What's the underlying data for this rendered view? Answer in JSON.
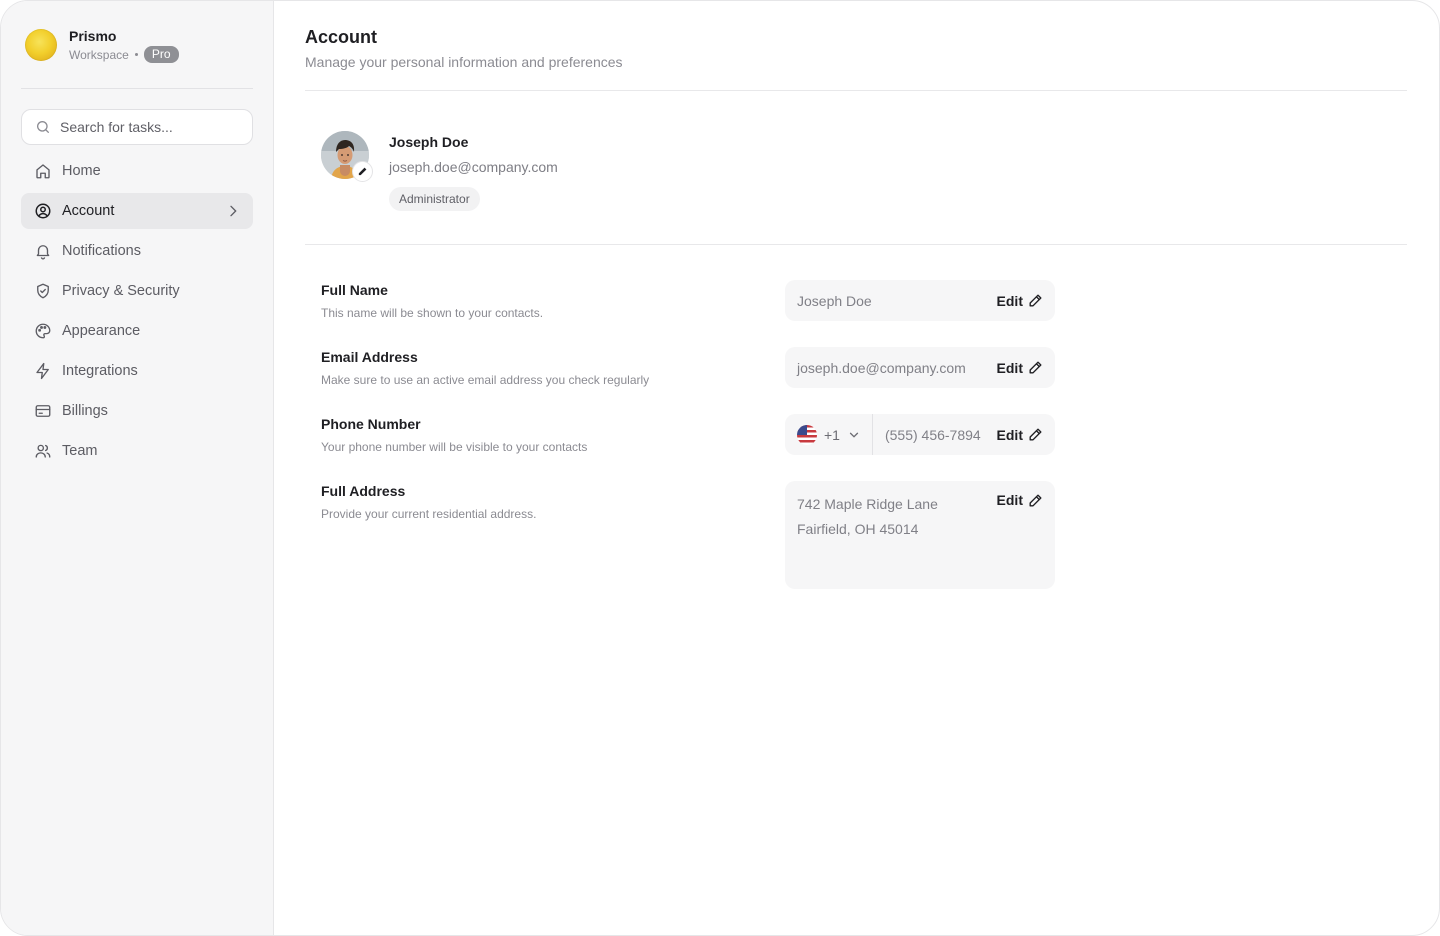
{
  "workspace": {
    "name": "Prismo",
    "type": "Workspace",
    "plan": "Pro"
  },
  "search": {
    "placeholder": "Search for tasks..."
  },
  "sidebar": {
    "items": [
      {
        "label": "Home",
        "icon": "home-icon"
      },
      {
        "label": "Account",
        "icon": "user-circle-icon",
        "active": true
      },
      {
        "label": "Notifications",
        "icon": "bell-icon"
      },
      {
        "label": "Privacy & Security",
        "icon": "shield-icon"
      },
      {
        "label": "Appearance",
        "icon": "palette-icon"
      },
      {
        "label": "Integrations",
        "icon": "bolt-icon"
      },
      {
        "label": "Billings",
        "icon": "credit-card-icon"
      },
      {
        "label": "Team",
        "icon": "users-icon"
      }
    ]
  },
  "page": {
    "title": "Account",
    "subtitle": "Manage your personal information and preferences"
  },
  "profile": {
    "name": "Joseph Doe",
    "email": "joseph.doe@company.com",
    "role": "Administrator"
  },
  "fields": {
    "edit_label": "Edit",
    "full_name": {
      "title": "Full Name",
      "description": "This name will be shown to your contacts.",
      "value": "Joseph Doe"
    },
    "email": {
      "title": "Email Address",
      "description": "Make sure to use an active email address you check regularly",
      "value": "joseph.doe@company.com"
    },
    "phone": {
      "title": "Phone Number",
      "description": "Your phone number will be visible to your contacts",
      "country_code": "+1",
      "value": "(555) 456-7894"
    },
    "address": {
      "title": "Full Address",
      "description": "Provide your current residential address.",
      "line1": "742 Maple Ridge Lane",
      "line2": "Fairfield, OH 45014"
    }
  },
  "colors": {
    "sidebar_bg": "#f6f6f7",
    "active_item_bg": "#e8e8ea",
    "field_bg": "#f6f6f7",
    "text_primary": "#1f1f23",
    "text_muted": "#8b8b92",
    "badge_bg": "#8f9095"
  }
}
